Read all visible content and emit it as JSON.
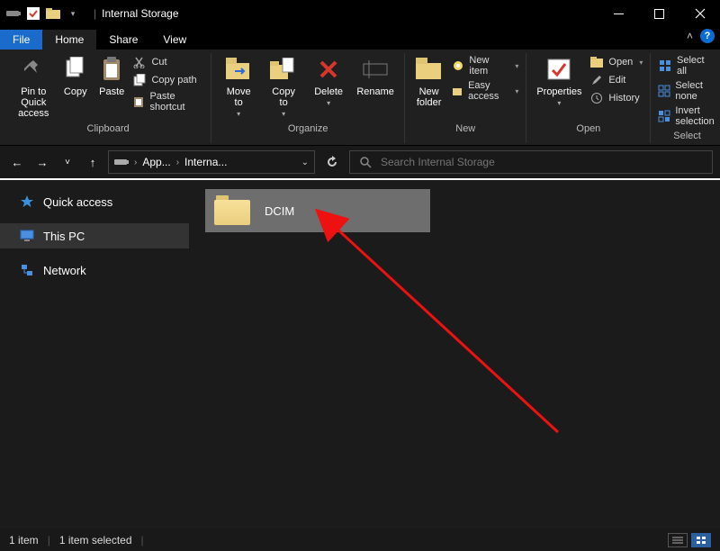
{
  "window": {
    "title": "Internal Storage"
  },
  "tabs": {
    "file": "File",
    "home": "Home",
    "share": "Share",
    "view": "View"
  },
  "ribbon": {
    "clipboard": {
      "pin": "Pin to Quick\naccess",
      "copy": "Copy",
      "paste": "Paste",
      "cut": "Cut",
      "copy_path": "Copy path",
      "paste_shortcut": "Paste shortcut",
      "label": "Clipboard"
    },
    "organize": {
      "move_to": "Move\nto",
      "copy_to": "Copy\nto",
      "delete": "Delete",
      "rename": "Rename",
      "label": "Organize"
    },
    "new": {
      "new_folder": "New\nfolder",
      "new_item": "New item",
      "easy_access": "Easy access",
      "label": "New"
    },
    "open": {
      "properties": "Properties",
      "open": "Open",
      "edit": "Edit",
      "history": "History",
      "label": "Open"
    },
    "select": {
      "select_all": "Select all",
      "select_none": "Select none",
      "invert": "Invert selection",
      "label": "Select"
    }
  },
  "breadcrumbs": {
    "b1": "App...",
    "b2": "Interna..."
  },
  "search": {
    "placeholder": "Search Internal Storage"
  },
  "sidebar": {
    "quick_access": "Quick access",
    "this_pc": "This PC",
    "network": "Network"
  },
  "content": {
    "folder1": "DCIM"
  },
  "status": {
    "count": "1 item",
    "selected": "1 item selected"
  }
}
